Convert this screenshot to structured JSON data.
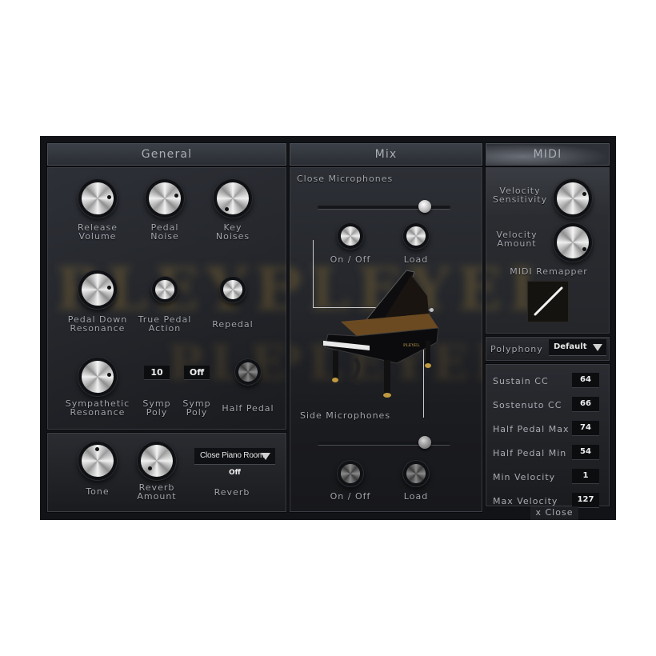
{
  "tabs": {
    "general": "General",
    "mix": "Mix",
    "midi": "MIDI"
  },
  "watermark": "PLEYEL",
  "general": {
    "knobs": [
      {
        "label": "Release Volume",
        "l1": "Release",
        "l2": "Volume"
      },
      {
        "label": "Pedal Noise",
        "l1": "Pedal",
        "l2": "Noise"
      },
      {
        "label": "Key Noises",
        "l1": "Key",
        "l2": "Noises"
      },
      {
        "label": "Pedal Down Resonance",
        "l1": "Pedal Down",
        "l2": "Resonance"
      },
      {
        "label": "True Pedal Action",
        "l1": "True Pedal",
        "l2": "Action"
      },
      {
        "label": "Repedal",
        "l1": "Repedal",
        "l2": ""
      },
      {
        "label": "Sympathetic Resonance",
        "l1": "Sympathetic",
        "l2": "Resonance"
      },
      {
        "label": "Half Pedal",
        "l1": "Half Pedal",
        "l2": ""
      }
    ],
    "symp_poly_1": {
      "value": "10",
      "l1": "Symp",
      "l2": "Poly"
    },
    "symp_poly_2": {
      "value": "Off",
      "l1": "Symp",
      "l2": "Poly"
    },
    "tone": {
      "label": "Tone"
    },
    "reverb_amount": {
      "l1": "Reverb",
      "l2": "Amount"
    },
    "reverb": {
      "preset": "Close Piano Room",
      "state": "Off",
      "label": "Reverb"
    }
  },
  "mix": {
    "close": {
      "title": "Close Microphones",
      "level_fraction": 0.84,
      "on_off": "On / Off",
      "load": "Load"
    },
    "side": {
      "title": "Side Microphones",
      "level_fraction": 0.84,
      "on_off": "On / Off",
      "load": "Load"
    },
    "piano_brand": "PLEYEL"
  },
  "midi": {
    "velocity_sensitivity": {
      "l1": "Velocity",
      "l2": "Sensitivity"
    },
    "velocity_amount": {
      "l1": "Velocity",
      "l2": "Amount"
    },
    "remapper_label": "MIDI Remapper",
    "polyphony_label": "Polyphony",
    "polyphony_value": "Default",
    "cc": [
      {
        "label": "Sustain CC",
        "value": "64"
      },
      {
        "label": "Sostenuto CC",
        "value": "66"
      },
      {
        "label": "Half Pedal Max",
        "value": "74"
      },
      {
        "label": "Half Pedal Min",
        "value": "54"
      },
      {
        "label": "Min Velocity",
        "value": "1"
      },
      {
        "label": "Max Velocity",
        "value": "127"
      }
    ],
    "close_label": "x Close"
  }
}
